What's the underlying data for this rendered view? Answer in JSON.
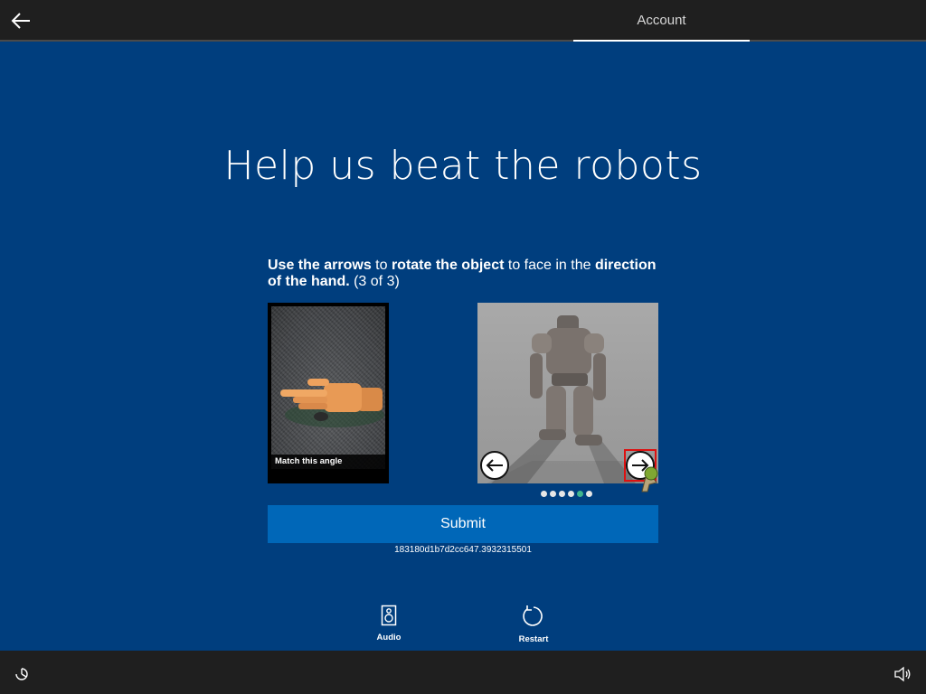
{
  "header": {
    "tab_label": "Account"
  },
  "page": {
    "title": "Help us beat the robots"
  },
  "instruction": {
    "part1_bold": "Use the arrows",
    "part2": " to ",
    "part3_bold": "rotate the object",
    "part4": " to face in the ",
    "part5_bold": "direction of the hand.",
    "part6": " (3 of 3)"
  },
  "reference_image": {
    "caption": "Match this angle"
  },
  "object_viewer": {
    "dots_total": 6,
    "active_dot": 5
  },
  "actions": {
    "submit_label": "Submit",
    "session_id": "183180d1b7d2cc647.3932315501",
    "audio_label": "Audio",
    "restart_label": "Restart"
  },
  "colors": {
    "background": "#003e7e",
    "bar": "#1f1f1f",
    "submit": "#0067b8",
    "active_dot": "#3fb58e"
  },
  "icons": {
    "back": "back-arrow-icon",
    "left_arrow": "arrow-left-icon",
    "right_arrow": "arrow-right-icon",
    "audio": "speaker-icon",
    "restart": "restart-icon",
    "ease_of_access": "ease-of-access-icon",
    "volume": "volume-icon"
  }
}
